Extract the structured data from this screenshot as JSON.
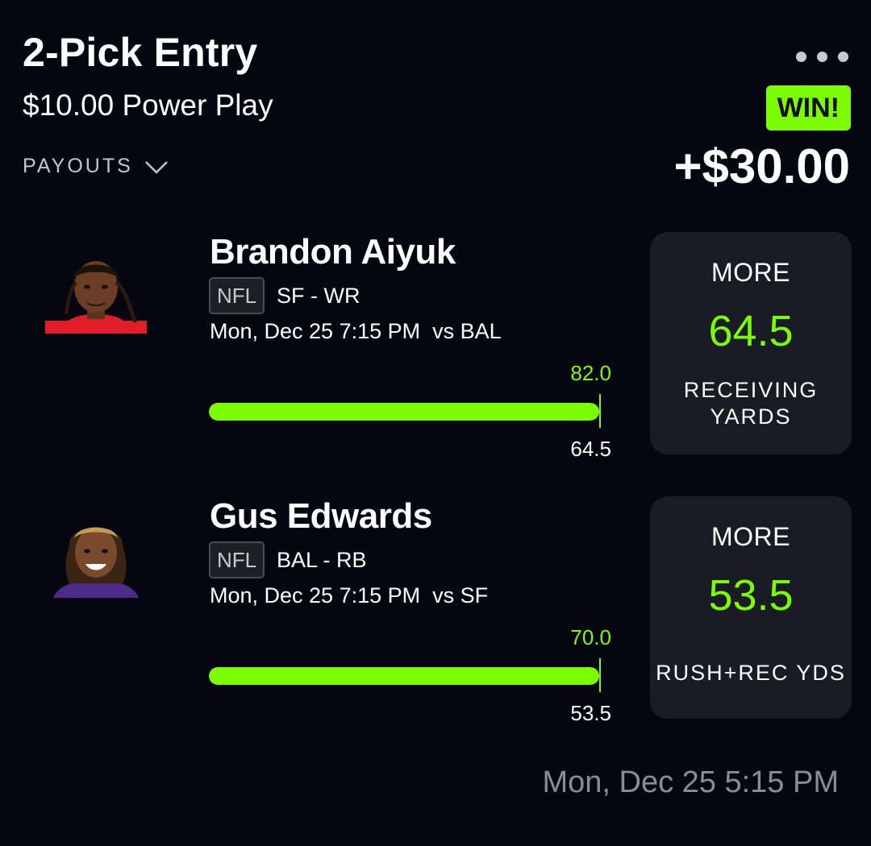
{
  "entry": {
    "title": "2-Pick Entry",
    "subtitle": "$10.00 Power Play",
    "payouts_label": "PAYOUTS",
    "result_badge": "WIN!",
    "payout_amount": "+$30.00"
  },
  "picks": [
    {
      "name": "Brandon Aiyuk",
      "league": "NFL",
      "team_pos": "SF - WR",
      "game_time": "Mon, Dec 25 7:15 PM  vs BAL",
      "actual": "82.0",
      "line": "64.5",
      "direction": "MORE",
      "line_display": "64.5",
      "stat_line1": "RECEIVING",
      "stat_line2": "YARDS",
      "progress_percent": 100,
      "jersey_color": "#e11d2a"
    },
    {
      "name": "Gus Edwards",
      "league": "NFL",
      "team_pos": "BAL - RB",
      "game_time": "Mon, Dec 25 7:15 PM  vs SF",
      "actual": "70.0",
      "line": "53.5",
      "direction": "MORE",
      "line_display": "53.5",
      "stat_line1": "RUSH+REC YDS",
      "progress_percent": 100,
      "jersey_color": "#4b2a8a"
    }
  ],
  "placed_time": "Mon, Dec 25 5:15 PM",
  "colors": {
    "accent": "#7cfc00",
    "background": "#05060f",
    "card": "#1a1b24"
  }
}
